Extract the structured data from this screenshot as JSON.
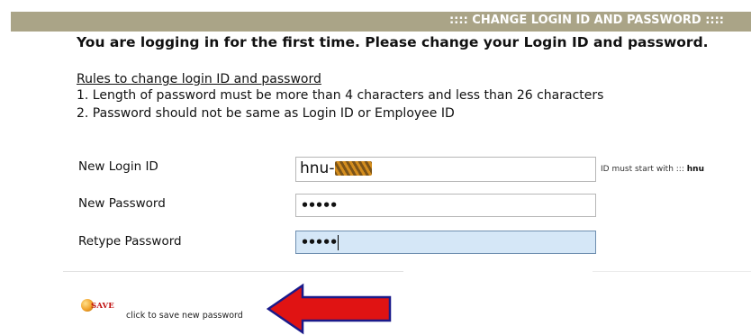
{
  "header": {
    "title": ":::: CHANGE LOGIN ID AND PASSWORD ::::"
  },
  "notice": "You are logging in for the first time. Please change your Login ID and password.",
  "rules": {
    "heading": "Rules to change login ID and password",
    "items": [
      "1. Length of password must be more than 4 characters and less than 26 characters",
      "2. Password should not be same as Login ID or Employee ID"
    ]
  },
  "form": {
    "login_id": {
      "label": "New Login ID",
      "value": "hnu-069",
      "hint_prefix": "ID must start with :::",
      "hint_value": "hnu"
    },
    "password": {
      "label": "New Password",
      "value": "•••••"
    },
    "retype": {
      "label": "Retype Password",
      "value": "•••••"
    }
  },
  "actions": {
    "save_label": "SAVE",
    "save_hint": "click to save new password"
  },
  "colors": {
    "header_bg": "#aaa487",
    "focused_field_bg": "#d5e7f7",
    "arrow": "#e01313",
    "save_text": "#c01010"
  },
  "icons": [
    "save-icon",
    "red-arrow-icon"
  ]
}
